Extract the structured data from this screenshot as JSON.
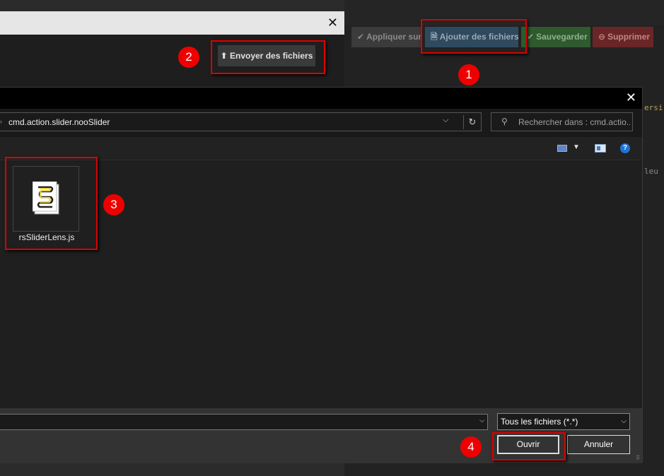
{
  "toolbar": {
    "apply_label": "Appliquer sur",
    "add_label": "Ajouter des fichiers",
    "save_label": "Sauvegarder",
    "delete_label": "Supprimer"
  },
  "code_fragments": [
    "ersi",
    "leu"
  ],
  "upload_modal": {
    "close_glyph": "✕",
    "send_label": "Envoyer des fichiers"
  },
  "dialog": {
    "close_glyph": "✕",
    "address_path": "cmd.action.slider.nooSlider",
    "search_placeholder": "Rechercher dans : cmd.actio...",
    "files": [
      {
        "name": "rsSliderLens.js",
        "icon": "script-file-icon"
      }
    ],
    "filename_value": "",
    "filter_label": "Tous les fichiers (*.*)",
    "open_label": "Ouvrir",
    "cancel_label": "Annuler"
  },
  "annotations": {
    "badges": [
      "1",
      "2",
      "3",
      "4"
    ],
    "color": "#dd0000"
  }
}
